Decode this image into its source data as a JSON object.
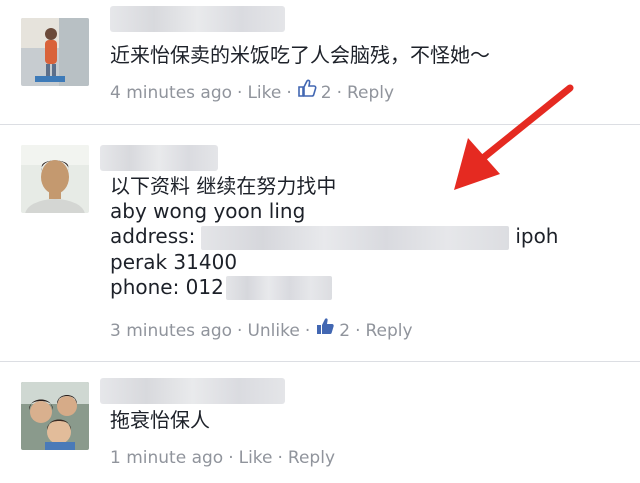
{
  "comments": [
    {
      "lines": [
        "近来怡保卖的米饭吃了人会脑残，不怪她～"
      ],
      "time": "4 minutes ago",
      "like_label": "Like",
      "like_count": "2",
      "reply_label": "Reply"
    },
    {
      "lines": [
        "以下资料 继续在努力找中",
        "aby wong yoon ling"
      ],
      "address_label": "address:",
      "address_suffix": "ipoh",
      "line_perak": "perak 31400",
      "phone_label": "phone: 012",
      "time": "3 minutes ago",
      "like_label": "Unlike",
      "like_count": "2",
      "reply_label": "Reply"
    },
    {
      "lines": [
        "拖衰怡保人"
      ],
      "time": "1 minute ago",
      "like_label": "Like",
      "reply_label": "Reply"
    }
  ],
  "separator": "·",
  "colors": {
    "meta": "#90949c",
    "like_blue": "#4267b2",
    "arrow": "#e52a21"
  },
  "icons": {
    "like": "thumbs-up-icon",
    "annotation": "red-arrow"
  }
}
